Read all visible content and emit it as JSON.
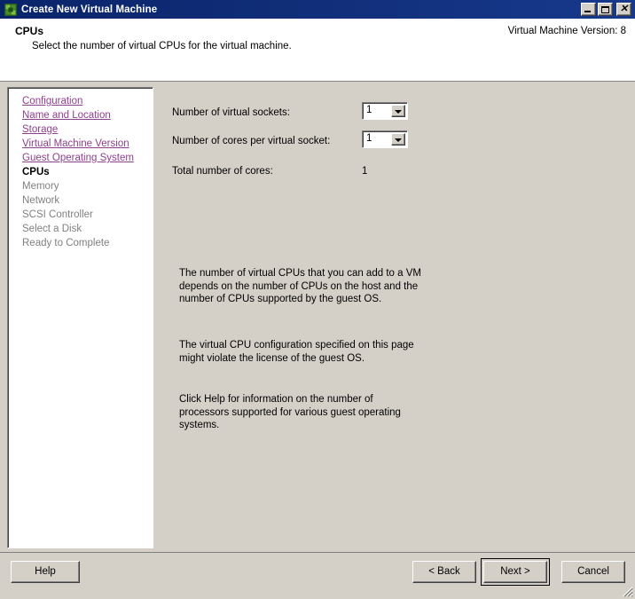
{
  "window": {
    "title": "Create New Virtual Machine",
    "app_icon": "vmware-squares-icon",
    "minimize_label": "_",
    "maximize_label": "",
    "close_label": "x",
    "titlebar_color": "#0a246a",
    "face_color": "#d4d0c8"
  },
  "header": {
    "title": "CPUs",
    "subtitle": "Select the number of virtual CPUs for the virtual machine.",
    "version": "Virtual Machine Version: 8"
  },
  "sidebar": {
    "items": [
      {
        "label": "Configuration",
        "state": "done"
      },
      {
        "label": "Name and Location",
        "state": "done"
      },
      {
        "label": "Storage",
        "state": "done"
      },
      {
        "label": "Virtual Machine Version",
        "state": "done"
      },
      {
        "label": "Guest Operating System",
        "state": "done"
      },
      {
        "label": "CPUs",
        "state": "current"
      },
      {
        "label": "Memory",
        "state": "todo"
      },
      {
        "label": "Network",
        "state": "todo"
      },
      {
        "label": "SCSI Controller",
        "state": "todo"
      },
      {
        "label": "Select a Disk",
        "state": "todo"
      },
      {
        "label": "Ready to Complete",
        "state": "todo"
      }
    ],
    "link_color": "#8e3f8e",
    "disabled_color": "#808080"
  },
  "form": {
    "sockets_label": "Number of virtual sockets:",
    "sockets_value": "1",
    "cores_label": "Number of cores per virtual socket:",
    "cores_value": "1",
    "total_label": "Total number of cores:",
    "total_value": "1"
  },
  "notes": {
    "paragraph_1": "The number of virtual CPUs that you can add to a VM depends on the number of CPUs on the host and the number of CPUs supported by the guest OS.",
    "paragraph_2": "The virtual CPU configuration specified on this page might violate the license of the guest OS.",
    "paragraph_3": "Click Help for information on the number of processors supported for various guest operating systems."
  },
  "footer": {
    "help_label": "Help",
    "back_label": "< Back",
    "next_label": "Next >",
    "cancel_label": "Cancel"
  }
}
